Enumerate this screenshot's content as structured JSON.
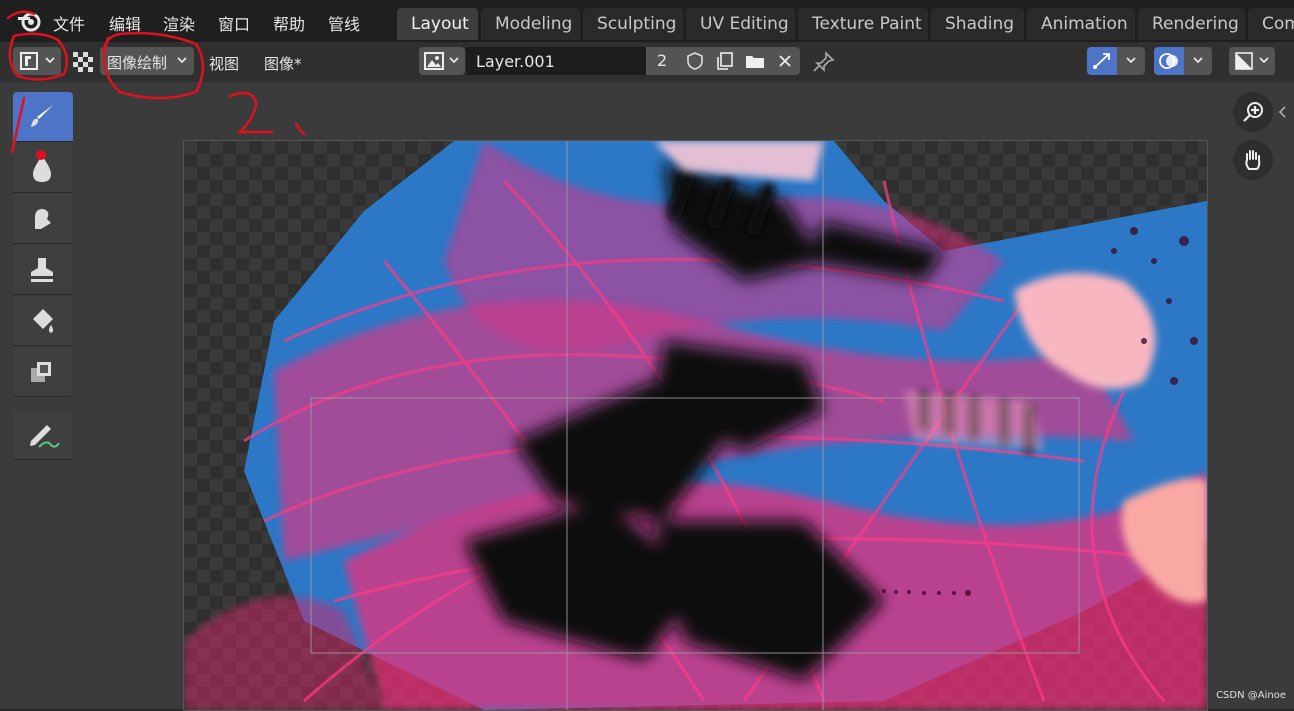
{
  "menu": [
    "文件",
    "编辑",
    "渲染",
    "窗口",
    "帮助",
    "管线"
  ],
  "workspace_tabs": [
    {
      "label": "Layout",
      "active": true
    },
    {
      "label": "Modeling",
      "active": false
    },
    {
      "label": "Sculpting",
      "active": false
    },
    {
      "label": "UV Editing",
      "active": false
    },
    {
      "label": "Texture Paint",
      "active": false
    },
    {
      "label": "Shading",
      "active": false
    },
    {
      "label": "Animation",
      "active": false
    },
    {
      "label": "Rendering",
      "active": false
    },
    {
      "label": "Com",
      "active": false
    }
  ],
  "header": {
    "mode": "图像绘制",
    "view": "视图",
    "image": "图像*",
    "image_name": "Layer.001",
    "users": "2"
  },
  "toolbar": {
    "tools": [
      "draw-brush",
      "soften-brush",
      "smear-brush",
      "clone-brush",
      "fill-brush",
      "mask-brush",
      "annotate"
    ]
  },
  "annotations": {
    "step1": "1",
    "step2": "2、"
  },
  "watermark": "CSDN @Ainoe",
  "colors": {
    "accent": "#4d74c6",
    "annotation": "#e01020",
    "paint_pink": "#f0307a",
    "paint_blue": "#2c7ac8"
  }
}
